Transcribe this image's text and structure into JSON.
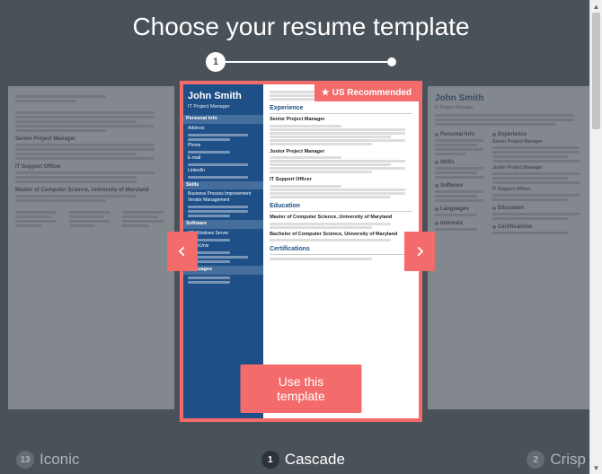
{
  "header": {
    "title": "Choose your resume template"
  },
  "stepper": {
    "current": "1"
  },
  "badge": {
    "text": "US Recommended"
  },
  "arrows": {
    "prev": "Previous",
    "next": "Next"
  },
  "cta": {
    "label": "Use this template"
  },
  "templates": {
    "left": {
      "num": "13",
      "name": "Iconic"
    },
    "center": {
      "num": "1",
      "name": "Cascade"
    },
    "right": {
      "num": "2",
      "name": "Crisp"
    }
  },
  "resume": {
    "name": "John Smith",
    "role": "IT Project Manager",
    "sections": {
      "personal": "Personal Info",
      "skills": "Skills",
      "software": "Software",
      "languages": "Languages",
      "experience": "Experience",
      "education": "Education",
      "certifications": "Certifications",
      "interests": "Interests"
    },
    "jobs": {
      "j1": "Senior Project Manager",
      "j2": "Junior Project Manager",
      "j3": "IT Support Officer"
    },
    "edu": {
      "e1": "Master of Computer Science, University of Maryland",
      "e2": "Bachelor of Computer Science, University of Maryland"
    },
    "side_labels": {
      "address": "Address",
      "phone": "Phone",
      "email": "E-mail",
      "linkedin": "LinkedIn",
      "s1": "Business Process Improvement",
      "s2": "Vendor Management",
      "sw1": "MS Windows Server",
      "sw2": "Linux/Unix"
    }
  }
}
